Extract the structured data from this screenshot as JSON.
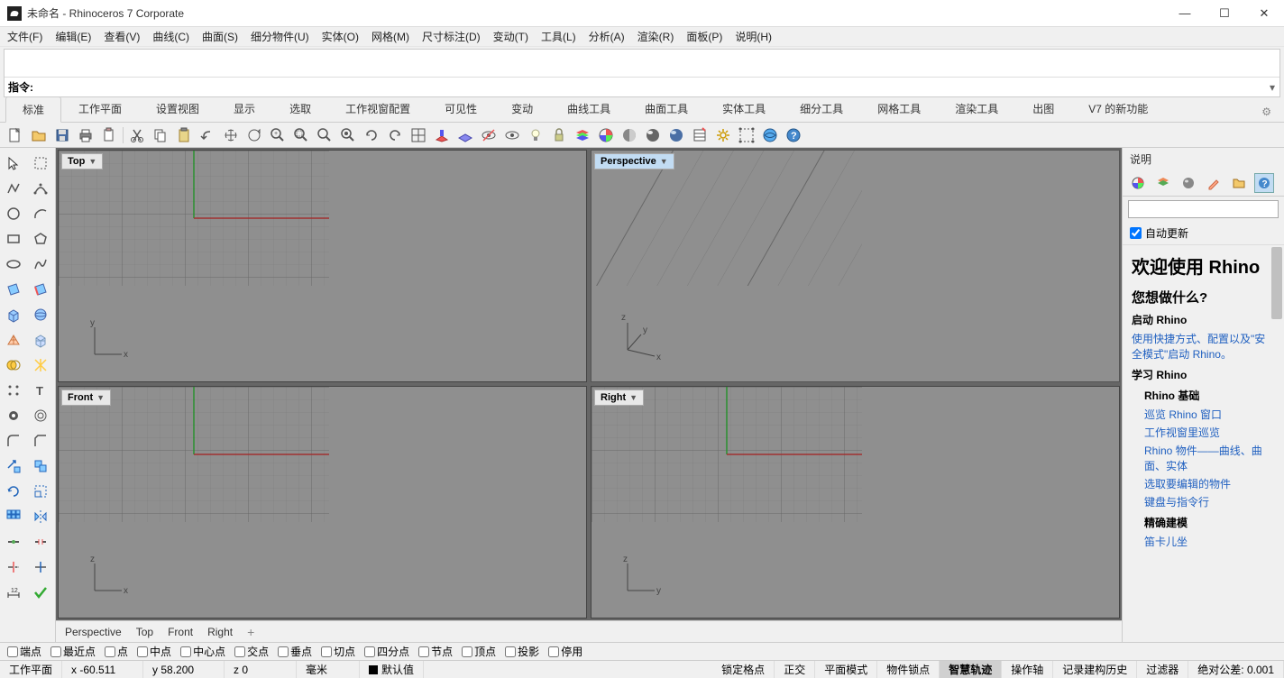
{
  "title": "未命名 - Rhinoceros 7 Corporate",
  "menubar": [
    "文件(F)",
    "编辑(E)",
    "查看(V)",
    "曲线(C)",
    "曲面(S)",
    "细分物件(U)",
    "实体(O)",
    "网格(M)",
    "尺寸标注(D)",
    "变动(T)",
    "工具(L)",
    "分析(A)",
    "渲染(R)",
    "面板(P)",
    "说明(H)"
  ],
  "command": {
    "label": "指令:"
  },
  "tabs": [
    "标准",
    "工作平面",
    "设置视图",
    "显示",
    "选取",
    "工作视窗配置",
    "可见性",
    "变动",
    "曲线工具",
    "曲面工具",
    "实体工具",
    "细分工具",
    "网格工具",
    "渲染工具",
    "出图",
    "V7 的新功能"
  ],
  "viewports": {
    "top": "Top",
    "perspective": "Perspective",
    "front": "Front",
    "right": "Right"
  },
  "viewporttabs": [
    "Perspective",
    "Top",
    "Front",
    "Right"
  ],
  "rightpanel": {
    "header": "说明",
    "auto_update": "自动更新",
    "welcome": "欢迎使用 Rhino",
    "q": "您想做什么?",
    "start_heading": "启动 Rhino",
    "start_link": "使用快捷方式、配置以及\"安全模式\"启动 Rhino。",
    "learn_heading": "学习 Rhino",
    "basics_heading": "Rhino 基础",
    "links": {
      "tour": "巡览 Rhino 窗口",
      "viewport_tour": "工作视窗里巡览",
      "objects": "Rhino 物件——曲线、曲面、实体",
      "select": "选取要编辑的物件",
      "keyboard": "键盘与指令行",
      "precise": "精确建模",
      "cartesian": "笛卡儿坐"
    }
  },
  "osnaps": [
    "端点",
    "最近点",
    "点",
    "中点",
    "中心点",
    "交点",
    "垂点",
    "切点",
    "四分点",
    "节点",
    "顶点",
    "投影",
    "停用"
  ],
  "status": {
    "cplane": "工作平面",
    "x": "x -60.511",
    "y": "y 58.200",
    "z": "z 0",
    "units": "毫米",
    "layer": "默认值",
    "gridsnap": "锁定格点",
    "ortho": "正交",
    "planar": "平面模式",
    "osnap": "物件锁点",
    "smart": "智慧轨迹",
    "gumball": "操作轴",
    "history": "记录建构历史",
    "filter": "过滤器",
    "tol": "绝对公差: 0.001"
  }
}
